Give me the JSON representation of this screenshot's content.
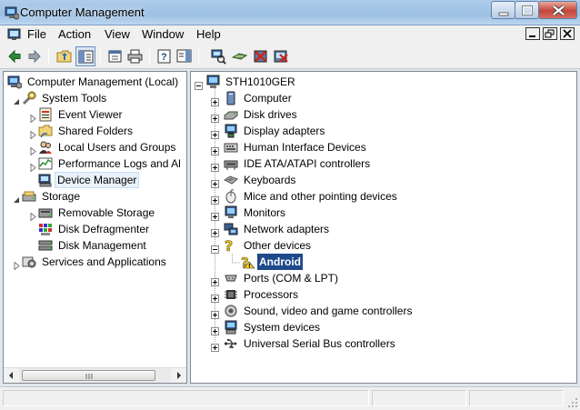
{
  "window": {
    "title": "Computer Management",
    "controls": {
      "minimize": "minimize",
      "maximize": "maximize",
      "close": "close"
    }
  },
  "menubar": {
    "items": [
      {
        "label": "File"
      },
      {
        "label": "Action"
      },
      {
        "label": "View"
      },
      {
        "label": "Window"
      },
      {
        "label": "Help"
      }
    ]
  },
  "toolbar": {
    "buttons": [
      {
        "icon": "back-arrow-icon"
      },
      {
        "icon": "forward-arrow-icon"
      },
      {
        "icon": "up-folder-icon"
      },
      {
        "icon": "show-hide-tree-icon"
      },
      {
        "icon": "properties-icon"
      },
      {
        "icon": "print-icon"
      },
      {
        "icon": "help-icon"
      },
      {
        "icon": "action-pane-icon"
      },
      {
        "icon": "scan-hardware-icon"
      },
      {
        "icon": "update-driver-icon"
      },
      {
        "icon": "disable-device-icon"
      },
      {
        "icon": "uninstall-device-icon"
      }
    ]
  },
  "left_tree": {
    "root": "Computer Management (Local)",
    "items": [
      {
        "label": "System Tools",
        "level": 1,
        "expander": "open"
      },
      {
        "label": "Event Viewer",
        "level": 2,
        "expander": "closed"
      },
      {
        "label": "Shared Folders",
        "level": 2,
        "expander": "closed"
      },
      {
        "label": "Local Users and Groups",
        "level": 2,
        "expander": "closed"
      },
      {
        "label": "Performance Logs and Al",
        "level": 2,
        "expander": "closed"
      },
      {
        "label": "Device Manager",
        "level": 2,
        "expander": "none",
        "selected": true
      },
      {
        "label": "Storage",
        "level": 1,
        "expander": "open"
      },
      {
        "label": "Removable Storage",
        "level": 2,
        "expander": "closed"
      },
      {
        "label": "Disk Defragmenter",
        "level": 2,
        "expander": "none"
      },
      {
        "label": "Disk Management",
        "level": 2,
        "expander": "none"
      },
      {
        "label": "Services and Applications",
        "level": 1,
        "expander": "closed"
      }
    ]
  },
  "right_tree": {
    "root": "STH1010GER",
    "items": [
      {
        "label": "Computer",
        "expander": "plus",
        "icon": "computer-icon"
      },
      {
        "label": "Disk drives",
        "expander": "plus",
        "icon": "disk-drive-icon"
      },
      {
        "label": "Display adapters",
        "expander": "plus",
        "icon": "display-adapter-icon"
      },
      {
        "label": "Human Interface Devices",
        "expander": "plus",
        "icon": "hid-icon"
      },
      {
        "label": "IDE ATA/ATAPI controllers",
        "expander": "plus",
        "icon": "ide-controller-icon"
      },
      {
        "label": "Keyboards",
        "expander": "plus",
        "icon": "keyboard-icon"
      },
      {
        "label": "Mice and other pointing devices",
        "expander": "plus",
        "icon": "mouse-icon"
      },
      {
        "label": "Monitors",
        "expander": "plus",
        "icon": "monitor-icon"
      },
      {
        "label": "Network adapters",
        "expander": "plus",
        "icon": "network-adapter-icon"
      },
      {
        "label": "Other devices",
        "expander": "minus",
        "icon": "unknown-device-icon"
      },
      {
        "label": "Android",
        "expander": "none",
        "icon": "warning-device-icon",
        "child": true,
        "selected": true
      },
      {
        "label": "Ports (COM & LPT)",
        "expander": "plus",
        "icon": "port-icon"
      },
      {
        "label": "Processors",
        "expander": "plus",
        "icon": "processor-icon"
      },
      {
        "label": "Sound, video and game controllers",
        "expander": "plus",
        "icon": "sound-icon"
      },
      {
        "label": "System devices",
        "expander": "plus",
        "icon": "system-device-icon"
      },
      {
        "label": "Universal Serial Bus controllers",
        "expander": "plus",
        "icon": "usb-icon"
      }
    ]
  },
  "colors": {
    "selection": "#1f4a8a",
    "titlebar": "#9cc0e3",
    "pane_border": "#828790"
  }
}
